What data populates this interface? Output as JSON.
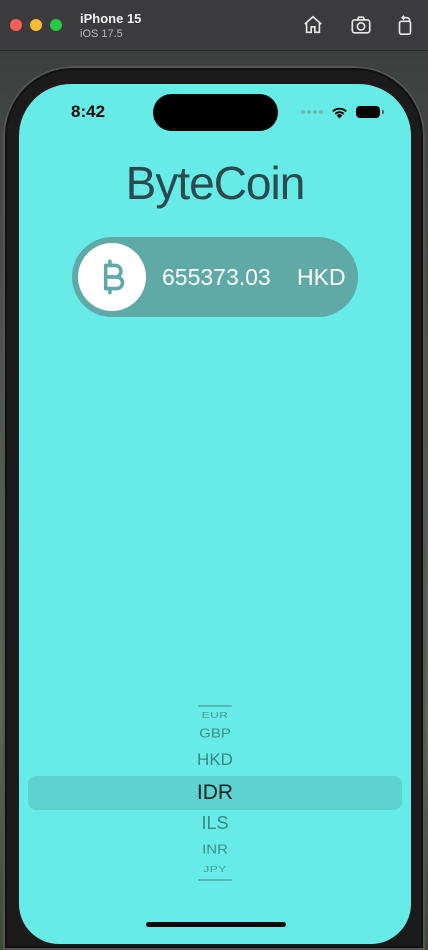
{
  "simulator": {
    "device_name": "iPhone 15",
    "os_version": "iOS 17.5",
    "buttons": {
      "home_icon": "home-icon",
      "screenshot_icon": "camera-icon",
      "rotate_icon": "rotate-icon"
    }
  },
  "status_bar": {
    "time": "8:42",
    "icons": [
      "cellular-dots-icon",
      "wifi-icon",
      "battery-icon"
    ]
  },
  "app": {
    "title": "ByteCoin",
    "rate": {
      "value": "655373.03",
      "currency": "HKD",
      "icon": "bitcoin-icon"
    }
  },
  "picker": {
    "selected_index": 3,
    "items": [
      "EUR",
      "GBP",
      "HKD",
      "IDR",
      "ILS",
      "INR",
      "JPY"
    ]
  },
  "colors": {
    "background": "#66ebe6",
    "rate_pill": "#5fa9a6",
    "title_text": "#2a4a4f",
    "picker_selection": "#5cd3cf"
  }
}
